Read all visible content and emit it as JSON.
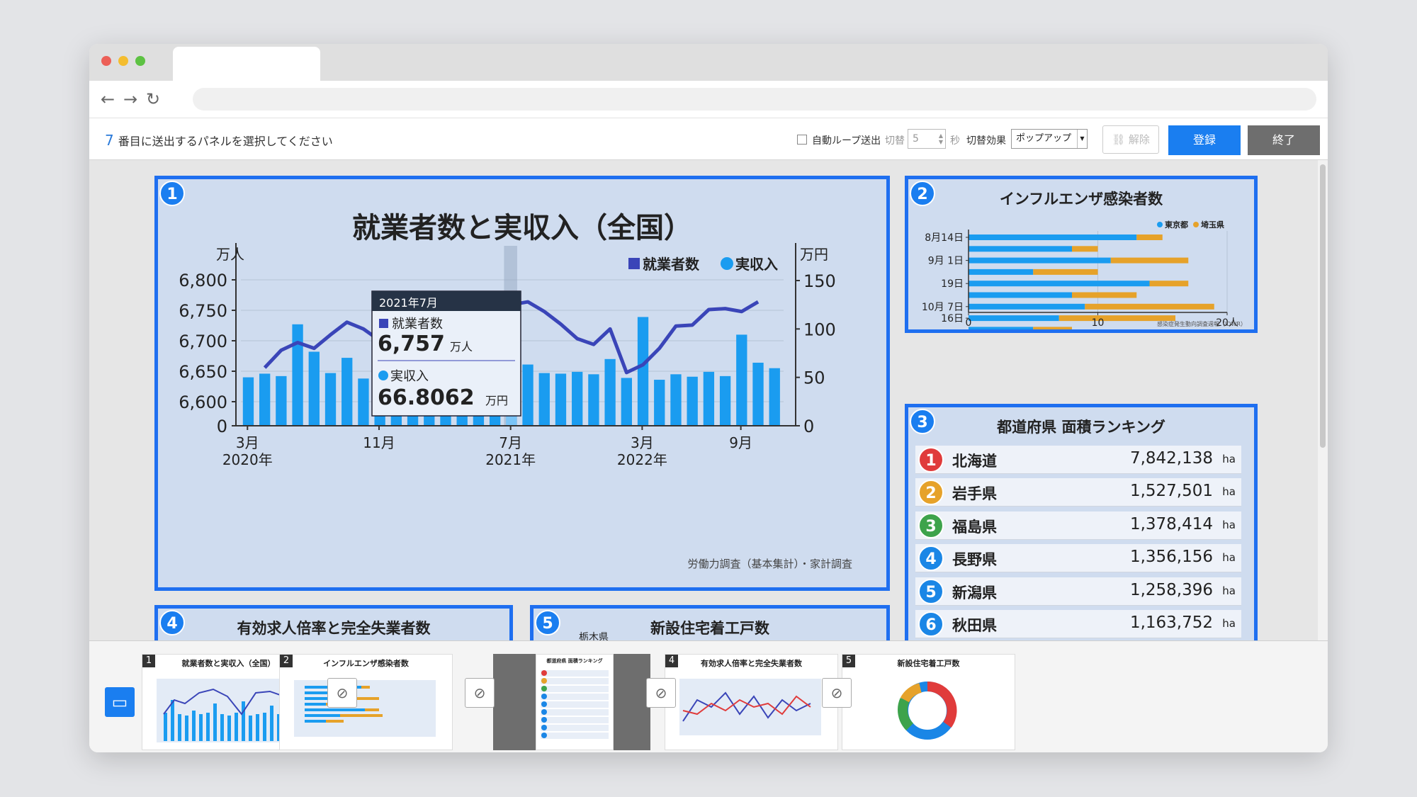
{
  "toolbar": {
    "prompt_num": "7",
    "prompt_text": "番目に送出するパネルを選択してください",
    "autoloop_label": "自動ループ送出",
    "interval_label": "切替",
    "interval_value": "5",
    "seconds_label": "秒",
    "effect_label": "切替効果",
    "effect_value": "ポップアップ",
    "clear_label": "解除",
    "register_label": "登録",
    "exit_label": "終了"
  },
  "panel1": {
    "num": "1",
    "title": "就業者数と実収入（全国）",
    "left_unit": "万人",
    "right_unit": "万円",
    "legend_employed": "就業者数",
    "legend_income": "実収入",
    "source": "労働力調査（基本集計）・家計調査",
    "tooltip": {
      "date": "2021年7月",
      "employed_label": "就業者数",
      "employed_value": "6,757",
      "employed_unit": "万人",
      "income_label": "実収入",
      "income_value": "66.8062",
      "income_unit": "万円"
    }
  },
  "panel2": {
    "num": "2",
    "title": "インフルエンザ感染者数",
    "source": "感染症発生動向調査週報（IDWR）"
  },
  "panel3": {
    "num": "3",
    "title": "都道府県 面積ランキング",
    "unit": "ha",
    "rows": [
      {
        "rank": "1",
        "name": "北海道",
        "value": "7,842,138",
        "color": "#e03b3b"
      },
      {
        "rank": "2",
        "name": "岩手県",
        "value": "1,527,501",
        "color": "#e6a22a"
      },
      {
        "rank": "3",
        "name": "福島県",
        "value": "1,378,414",
        "color": "#3da34b"
      },
      {
        "rank": "4",
        "name": "長野県",
        "value": "1,356,156",
        "color": "#1a86e6"
      },
      {
        "rank": "5",
        "name": "新潟県",
        "value": "1,258,396",
        "color": "#1a86e6"
      },
      {
        "rank": "6",
        "name": "秋田県",
        "value": "1,163,752",
        "color": "#1a86e6"
      }
    ]
  },
  "panel4": {
    "num": "4",
    "title": "有効求人倍率と完全失業者数"
  },
  "panel5": {
    "num": "5",
    "title": "新設住宅着工戸数",
    "partial_label": "栃木県"
  },
  "chart_data": [
    {
      "type": "bar+line",
      "title": "就業者数と実収入（全国）",
      "y_left_label": "万人",
      "y_right_label": "万円",
      "y_left_ticks": [
        "0",
        "6,600",
        "6,650",
        "6,700",
        "6,750",
        "6,800"
      ],
      "y_right_ticks": [
        "0",
        "50",
        "100",
        "150"
      ],
      "x_ticks": [
        {
          "month": "3月",
          "year": "2020年",
          "index": 0
        },
        {
          "month": "11月",
          "year": "",
          "index": 8
        },
        {
          "month": "7月",
          "year": "2021年",
          "index": 16
        },
        {
          "month": "3月",
          "year": "2022年",
          "index": 24
        },
        {
          "month": "9月",
          "year": "",
          "index": 30
        }
      ],
      "series": [
        {
          "name": "就業者数",
          "color": "#1a9cf0",
          "values": [
            6640,
            6646,
            6642,
            6727,
            6682,
            6647,
            6672,
            6638,
            6690,
            6639,
            6673,
            6637,
            6649,
            6642,
            6650,
            6644,
            6703,
            6661,
            6647,
            6646,
            6649,
            6645,
            6670,
            6639,
            6739,
            6636,
            6645,
            6641,
            6649,
            6642,
            6710,
            6664,
            6655
          ]
        },
        {
          "name": "実収入",
          "color": "#3a45b8",
          "values": [
            null,
            60,
            78,
            86,
            80,
            94,
            107,
            100,
            88,
            95,
            100,
            108,
            114,
            116,
            112,
            119,
            125,
            128,
            118,
            105,
            90,
            84,
            100,
            55,
            63,
            80,
            103,
            104,
            120,
            121,
            118,
            128
          ]
        }
      ],
      "highlight_index": 16
    },
    {
      "type": "bar",
      "title": "インフルエンザ感染者数",
      "categories": [
        "8月14日",
        "9月 1日",
        "19日",
        "10月 7日",
        "16日"
      ],
      "x_ticks": [
        "0",
        "10",
        "20人"
      ],
      "series": [
        {
          "name": "東京都",
          "color": "#1a9cf0",
          "values": [
            13,
            8,
            11,
            5,
            14,
            8,
            9,
            7,
            5,
            2,
            2
          ]
        },
        {
          "name": "埼玉県",
          "color": "#e6a22a",
          "values": [
            2,
            2,
            6,
            5,
            3,
            5,
            10,
            9,
            3,
            4,
            1
          ]
        }
      ]
    }
  ],
  "tray": {
    "thumbs": [
      {
        "num": "1",
        "title": "就業者数と実収入（全国）"
      },
      {
        "num": "2",
        "title": "インフルエンザ感染者数"
      },
      {
        "num": "3",
        "title": "都道府県 面積ランキング"
      },
      {
        "num": "4",
        "title": "有効求人倍率と完全失業者数"
      },
      {
        "num": "5",
        "title": "新設住宅着工戸数"
      }
    ]
  }
}
